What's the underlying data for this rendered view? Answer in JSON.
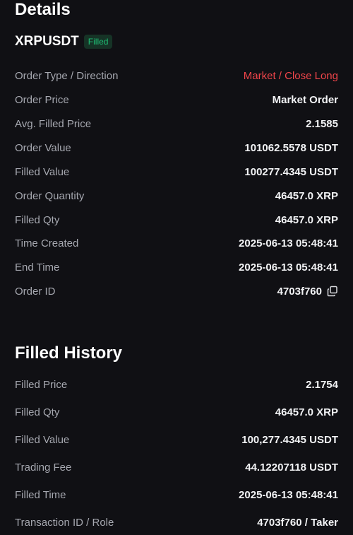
{
  "details": {
    "title": "Details",
    "symbol": "XRPUSDT",
    "status_badge": "Filled",
    "rows": [
      {
        "label": "Order Type / Direction",
        "value": "Market / Close Long"
      },
      {
        "label": "Order Price",
        "value": "Market Order"
      },
      {
        "label": "Avg. Filled Price",
        "value": "2.1585"
      },
      {
        "label": "Order Value",
        "value": "101062.5578 USDT"
      },
      {
        "label": "Filled Value",
        "value": "100277.4345 USDT"
      },
      {
        "label": "Order Quantity",
        "value": "46457.0 XRP"
      },
      {
        "label": "Filled Qty",
        "value": "46457.0 XRP"
      },
      {
        "label": "Time Created",
        "value": "2025-06-13 05:48:41"
      },
      {
        "label": "End Time",
        "value": "2025-06-13 05:48:41"
      },
      {
        "label": "Order ID",
        "value": "4703f760"
      }
    ]
  },
  "filled_history": {
    "title": "Filled History",
    "rows": [
      {
        "label": "Filled Price",
        "value": "2.1754"
      },
      {
        "label": "Filled Qty",
        "value": "46457.0 XRP"
      },
      {
        "label": "Filled Value",
        "value": "100,277.4345 USDT"
      },
      {
        "label": "Trading Fee",
        "value": "44.12207118 USDT"
      },
      {
        "label": "Filled Time",
        "value": "2025-06-13 05:48:41"
      },
      {
        "label": "Transaction ID / Role",
        "value": "4703f760 / Taker"
      }
    ]
  },
  "colors": {
    "background": "#101014",
    "direction_red": "#f0454a",
    "badge_green": "#1fbf75"
  },
  "icons": {
    "copy": "copy-icon"
  }
}
